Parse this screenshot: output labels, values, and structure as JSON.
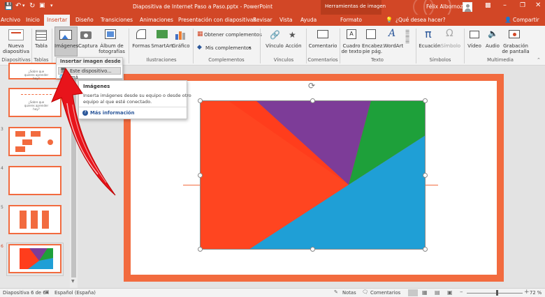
{
  "app": {
    "doc_title": "Diapositiva de Internet Paso a Paso.pptx  -  PowerPoint",
    "tools_context": "Herramientas de imagen",
    "user": "Félix Albornoz"
  },
  "colors": {
    "accent": "#d24726",
    "slide_border": "#f26b3f",
    "link": "#2b579a"
  },
  "tabs": [
    "Archivo",
    "Inicio",
    "Insertar",
    "Diseño",
    "Transiciones",
    "Animaciones",
    "Presentación con diapositivas",
    "Revisar",
    "Vista",
    "Ayuda",
    "Formato"
  ],
  "tell_me": "¿Qué desea hacer?",
  "share": "Compartir",
  "ribbon": {
    "nueva_diapositiva": "Nueva diapositiva",
    "tabla": "Tabla",
    "imagenes": "Imágenes",
    "captura": "Captura",
    "album": "Álbum de fotografías",
    "formas": "Formas",
    "smartart": "SmartArt",
    "grafico": "Gráfico",
    "obtener": "Obtener complementos",
    "mis": "Mis complementos",
    "vinculo": "Vínculo",
    "accion": "Acción",
    "comentario": "Comentario",
    "cuadro": "Cuadro de texto",
    "encabez": "Encabez. pie pág.",
    "wordart": "WordArt",
    "ecuacion": "Ecuación",
    "simbolo": "Símbolo",
    "video": "Vídeo",
    "audio": "Audio",
    "grabacion": "Grabación de pantalla",
    "groups": {
      "diapositivas": "Diapositivas",
      "tablas": "Tablas",
      "ilustraciones": "Ilustraciones",
      "complementos": "Complementos",
      "vinculos": "Vínculos",
      "comentarios": "Comentarios",
      "texto": "Texto",
      "simbolos": "Símbolos",
      "multimedia": "Multimedia"
    }
  },
  "dropdown": {
    "header": "Insertar imagen desde",
    "item1": "Este dispositivo...",
    "item2": "Imá"
  },
  "tooltip": {
    "title": "Imágenes",
    "body_line1": "Inserta imágenes desde su equipo o desde otro",
    "body_line2": "equipo al que esté conectado.",
    "more": "Más información"
  },
  "thumbnails": [
    {
      "num": "",
      "text": "¿Sobre que quieres aprender hoy?"
    },
    {
      "num": "",
      "text": "¿Sobre que quieres aprender hoy?"
    },
    {
      "num": "3",
      "text": ""
    },
    {
      "num": "4",
      "text": ""
    },
    {
      "num": "5",
      "text": ""
    },
    {
      "num": "6",
      "text": ""
    }
  ],
  "status": {
    "slide": "Diapositiva 6 de 6",
    "lang": "Español (España)",
    "notas": "Notas",
    "comentarios": "Comentarios",
    "zoom": "72 %",
    "zoom_value": 72
  }
}
